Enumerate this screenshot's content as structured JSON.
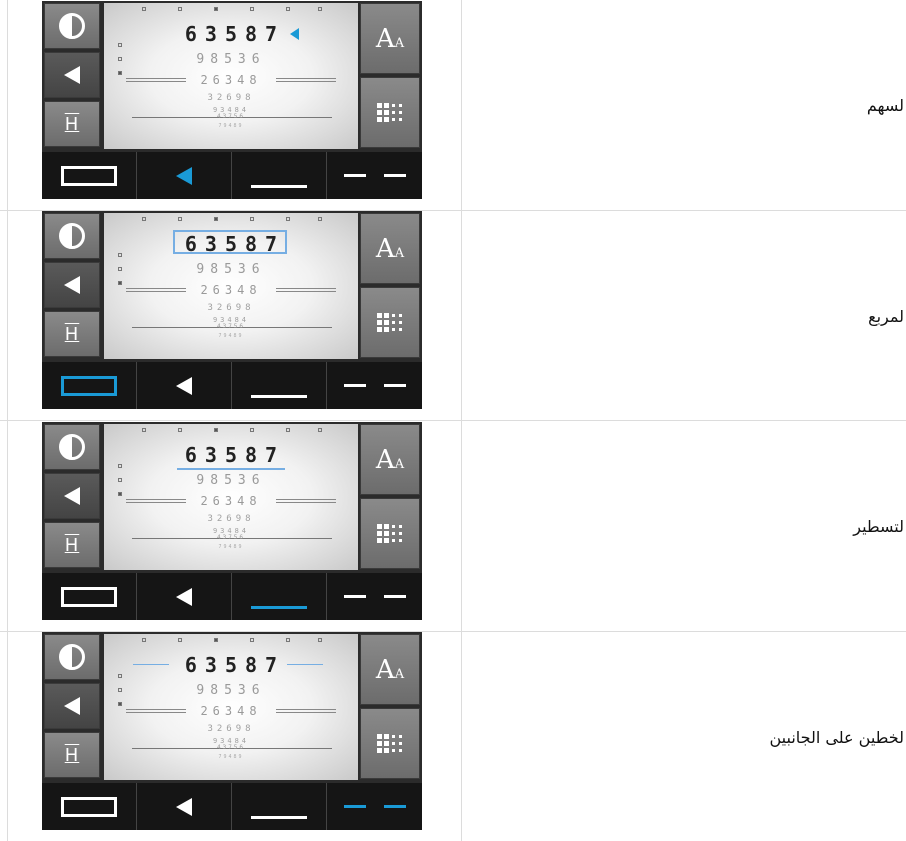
{
  "rows": [
    {
      "label": "لسهم",
      "selected": "arrow",
      "chart_line1": "63587",
      "chart_line2": "98536",
      "chart_line3": "26348",
      "chart_line4": "32698",
      "chart_line5": "93484",
      "chart_line6": "43756",
      "chart_line7": "79489"
    },
    {
      "label": "لمربع",
      "selected": "rectangle",
      "chart_line1": "63587",
      "chart_line2": "98536",
      "chart_line3": "26348",
      "chart_line4": "32698",
      "chart_line5": "93484",
      "chart_line6": "43756",
      "chart_line7": "79489"
    },
    {
      "label": "لتسطير",
      "selected": "underline",
      "chart_line1": "63587",
      "chart_line2": "98536",
      "chart_line3": "26348",
      "chart_line4": "32698",
      "chart_line5": "93484",
      "chart_line6": "43756",
      "chart_line7": "79489"
    },
    {
      "label": "لخطين على الجانبين",
      "selected": "side-lines",
      "chart_line1": "63587",
      "chart_line2": "98536",
      "chart_line3": "26348",
      "chart_line4": "32698",
      "chart_line5": "93484",
      "chart_line6": "43756",
      "chart_line7": "79489"
    }
  ],
  "buttons": {
    "font_size_label": "A",
    "font_size_small_label": "A",
    "split_label": "H"
  },
  "colors": {
    "accent_blue": "#1a9ad6",
    "highlight_blue": "#76aee3"
  }
}
